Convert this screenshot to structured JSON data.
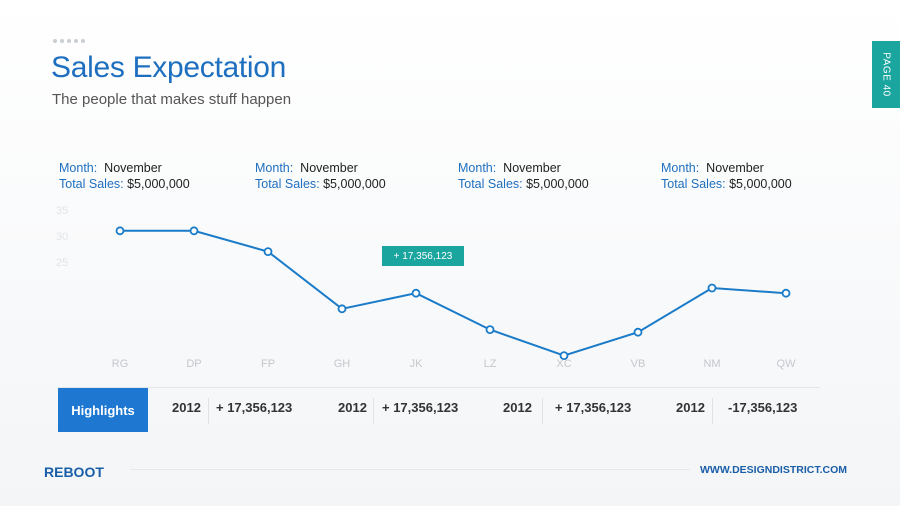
{
  "header": {
    "title": "Sales Expectation",
    "subtitle": "The people that makes stuff happen",
    "page_label": "PAGE 40"
  },
  "info_blocks": [
    {
      "month_label": "Month:",
      "month": "November",
      "sales_label": "Total Sales:",
      "sales": "$5,000,000"
    },
    {
      "month_label": "Month:",
      "month": "November",
      "sales_label": "Total Sales:",
      "sales": "$5,000,000"
    },
    {
      "month_label": "Month:",
      "month": "November",
      "sales_label": "Total Sales:",
      "sales": "$5,000,000"
    },
    {
      "month_label": "Month:",
      "month": "November",
      "sales_label": "Total Sales:",
      "sales": "$5,000,000"
    }
  ],
  "callout": "+ 17,356,123",
  "highlights": {
    "label": "Highlights",
    "items": [
      {
        "year": "2012",
        "value": "+ 17,356,123"
      },
      {
        "year": "2012",
        "value": "+ 17,356,123"
      },
      {
        "year": "2012",
        "value": "+ 17,356,123"
      },
      {
        "year": "2012",
        "value": "-17,356,123"
      }
    ]
  },
  "footer": {
    "brand": "REBOOT",
    "site": "WWW.DESIGNDISTRICT.COM"
  },
  "colors": {
    "accent": "#1e78d2",
    "teal": "#1aa59f",
    "line": "#1a7bc9"
  },
  "chart_data": {
    "type": "line",
    "categories": [
      "RG",
      "DP",
      "FP",
      "GH",
      "JK",
      "LZ",
      "XC",
      "VB",
      "NM",
      "QW"
    ],
    "values": [
      31,
      31,
      27,
      16,
      19,
      12,
      7,
      11.5,
      20,
      19
    ],
    "yticks": [
      "35",
      "30",
      "25"
    ],
    "ylim": [
      0,
      40
    ],
    "grid": false
  }
}
